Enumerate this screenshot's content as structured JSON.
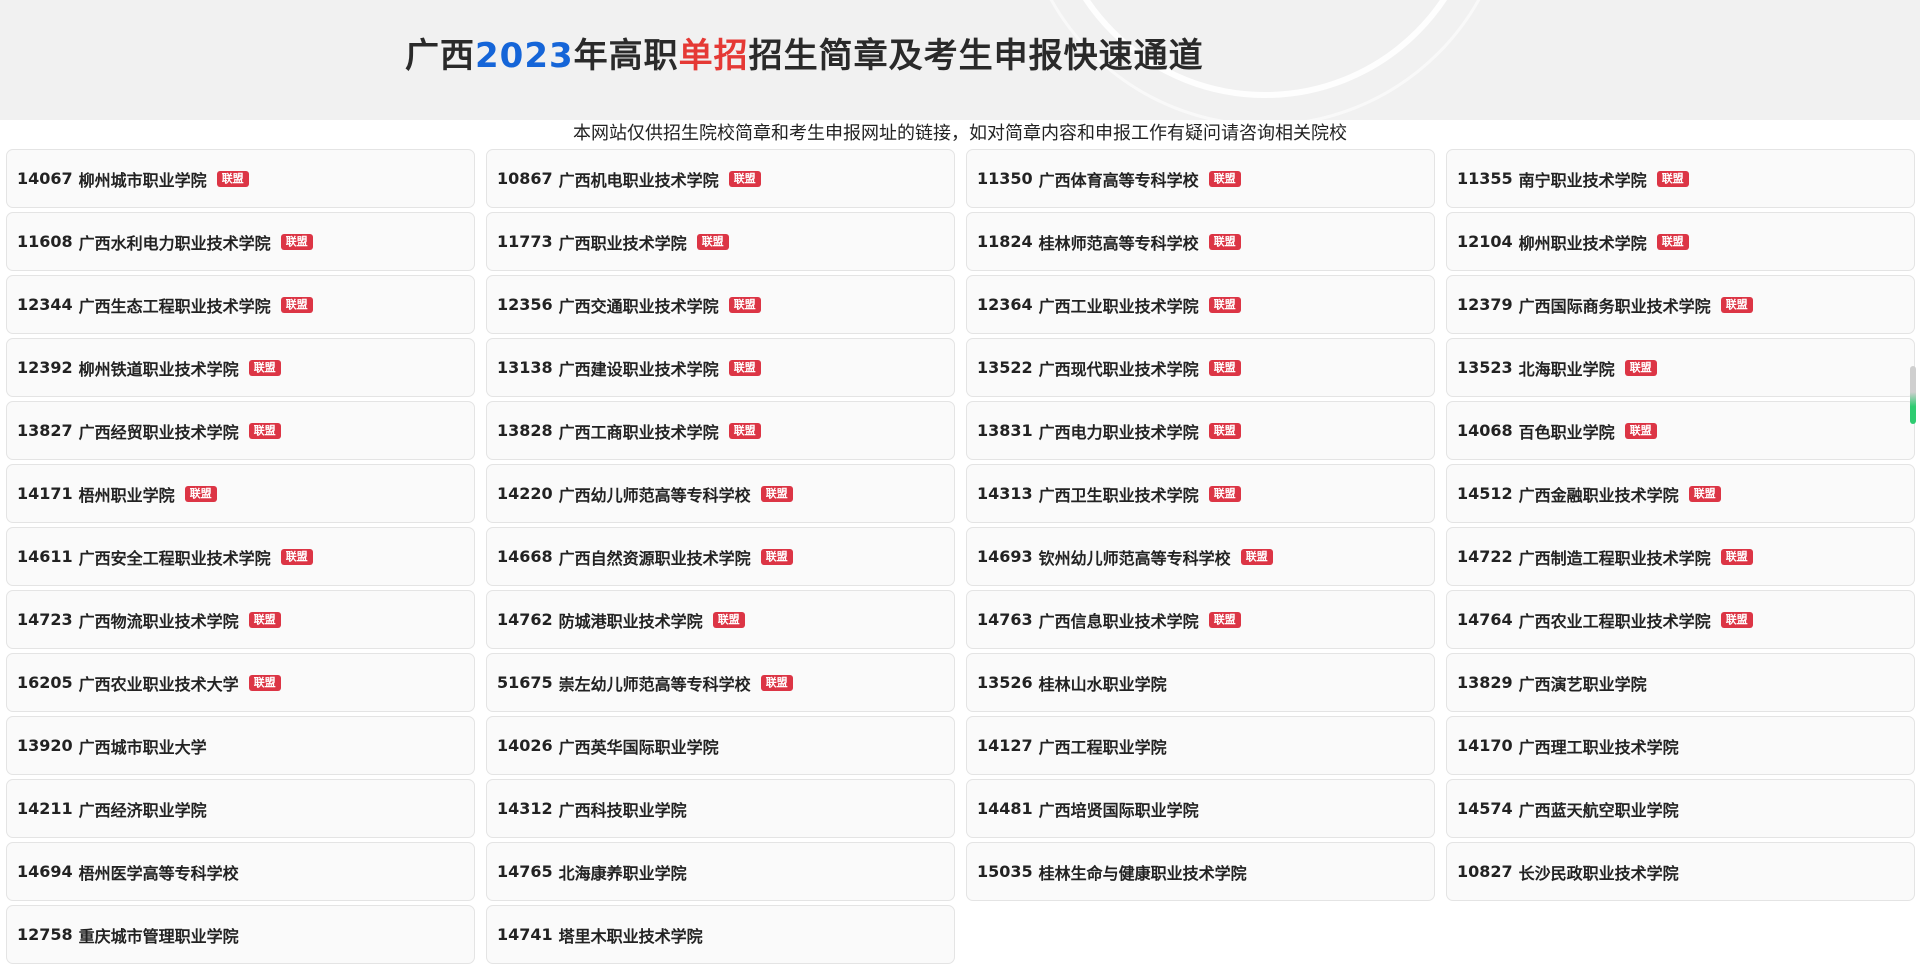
{
  "header": {
    "title_prefix": "广西",
    "title_year": "2023",
    "title_mid": "年高职",
    "title_highlight": "单招",
    "title_suffix": "招生简章及考生申报快速通道"
  },
  "notice": "本网站仅供招生院校简章和考生申报网址的链接，如对简章内容和申报工作有疑问请咨询相关院校",
  "badge_label": "联盟",
  "colors": {
    "accent_blue": "#1565d8",
    "accent_red": "#e53935",
    "badge_red": "#dc3545"
  },
  "schools": [
    {
      "code": "14067",
      "name": "柳州城市职业学院",
      "badge": true
    },
    {
      "code": "10867",
      "name": "广西机电职业技术学院",
      "badge": true
    },
    {
      "code": "11350",
      "name": "广西体育高等专科学校",
      "badge": true
    },
    {
      "code": "11355",
      "name": "南宁职业技术学院",
      "badge": true
    },
    {
      "code": "11608",
      "name": "广西水利电力职业技术学院",
      "badge": true
    },
    {
      "code": "11773",
      "name": "广西职业技术学院",
      "badge": true
    },
    {
      "code": "11824",
      "name": "桂林师范高等专科学校",
      "badge": true
    },
    {
      "code": "12104",
      "name": "柳州职业技术学院",
      "badge": true
    },
    {
      "code": "12344",
      "name": "广西生态工程职业技术学院",
      "badge": true
    },
    {
      "code": "12356",
      "name": "广西交通职业技术学院",
      "badge": true
    },
    {
      "code": "12364",
      "name": "广西工业职业技术学院",
      "badge": true
    },
    {
      "code": "12379",
      "name": "广西国际商务职业技术学院",
      "badge": true
    },
    {
      "code": "12392",
      "name": "柳州铁道职业技术学院",
      "badge": true
    },
    {
      "code": "13138",
      "name": "广西建设职业技术学院",
      "badge": true
    },
    {
      "code": "13522",
      "name": "广西现代职业技术学院",
      "badge": true
    },
    {
      "code": "13523",
      "name": "北海职业学院",
      "badge": true
    },
    {
      "code": "13827",
      "name": "广西经贸职业技术学院",
      "badge": true
    },
    {
      "code": "13828",
      "name": "广西工商职业技术学院",
      "badge": true
    },
    {
      "code": "13831",
      "name": "广西电力职业技术学院",
      "badge": true
    },
    {
      "code": "14068",
      "name": "百色职业学院",
      "badge": true
    },
    {
      "code": "14171",
      "name": "梧州职业学院",
      "badge": true
    },
    {
      "code": "14220",
      "name": "广西幼儿师范高等专科学校",
      "badge": true
    },
    {
      "code": "14313",
      "name": "广西卫生职业技术学院",
      "badge": true
    },
    {
      "code": "14512",
      "name": "广西金融职业技术学院",
      "badge": true
    },
    {
      "code": "14611",
      "name": "广西安全工程职业技术学院",
      "badge": true
    },
    {
      "code": "14668",
      "name": "广西自然资源职业技术学院",
      "badge": true
    },
    {
      "code": "14693",
      "name": "钦州幼儿师范高等专科学校",
      "badge": true
    },
    {
      "code": "14722",
      "name": "广西制造工程职业技术学院",
      "badge": true
    },
    {
      "code": "14723",
      "name": "广西物流职业技术学院",
      "badge": true
    },
    {
      "code": "14762",
      "name": "防城港职业技术学院",
      "badge": true
    },
    {
      "code": "14763",
      "name": "广西信息职业技术学院",
      "badge": true
    },
    {
      "code": "14764",
      "name": "广西农业工程职业技术学院",
      "badge": true
    },
    {
      "code": "16205",
      "name": "广西农业职业技术大学",
      "badge": true
    },
    {
      "code": "51675",
      "name": "崇左幼儿师范高等专科学校",
      "badge": true
    },
    {
      "code": "13526",
      "name": "桂林山水职业学院",
      "badge": false
    },
    {
      "code": "13829",
      "name": "广西演艺职业学院",
      "badge": false
    },
    {
      "code": "13920",
      "name": "广西城市职业大学",
      "badge": false
    },
    {
      "code": "14026",
      "name": "广西英华国际职业学院",
      "badge": false
    },
    {
      "code": "14127",
      "name": "广西工程职业学院",
      "badge": false
    },
    {
      "code": "14170",
      "name": "广西理工职业技术学院",
      "badge": false
    },
    {
      "code": "14211",
      "name": "广西经济职业学院",
      "badge": false
    },
    {
      "code": "14312",
      "name": "广西科技职业学院",
      "badge": false
    },
    {
      "code": "14481",
      "name": "广西培贤国际职业学院",
      "badge": false
    },
    {
      "code": "14574",
      "name": "广西蓝天航空职业学院",
      "badge": false
    },
    {
      "code": "14694",
      "name": "梧州医学高等专科学校",
      "badge": false
    },
    {
      "code": "14765",
      "name": "北海康养职业学院",
      "badge": false
    },
    {
      "code": "15035",
      "name": "桂林生命与健康职业技术学院",
      "badge": false
    },
    {
      "code": "10827",
      "name": "长沙民政职业技术学院",
      "badge": false
    },
    {
      "code": "12758",
      "name": "重庆城市管理职业学院",
      "badge": false
    },
    {
      "code": "14741",
      "name": "塔里木职业技术学院",
      "badge": false
    }
  ]
}
